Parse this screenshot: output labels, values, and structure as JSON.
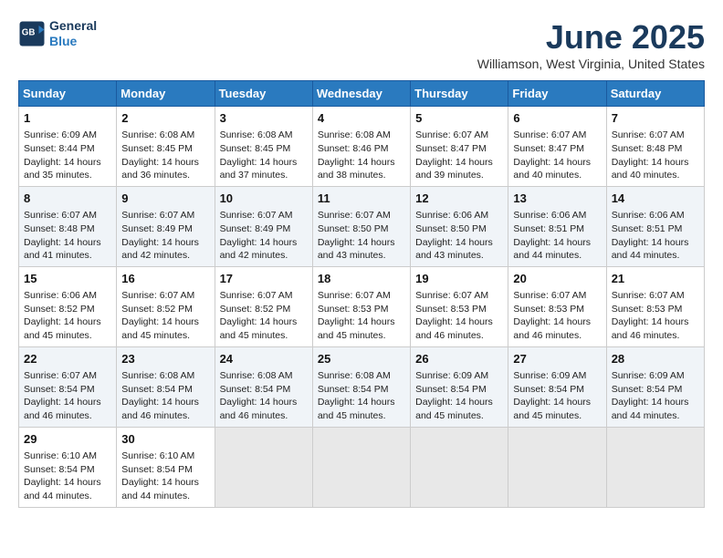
{
  "header": {
    "logo_line1": "General",
    "logo_line2": "Blue",
    "month": "June 2025",
    "location": "Williamson, West Virginia, United States"
  },
  "weekdays": [
    "Sunday",
    "Monday",
    "Tuesday",
    "Wednesday",
    "Thursday",
    "Friday",
    "Saturday"
  ],
  "weeks": [
    [
      {
        "day": "1",
        "rise": "6:09 AM",
        "set": "8:44 PM",
        "daylight": "14 hours and 35 minutes."
      },
      {
        "day": "2",
        "rise": "6:08 AM",
        "set": "8:45 PM",
        "daylight": "14 hours and 36 minutes."
      },
      {
        "day": "3",
        "rise": "6:08 AM",
        "set": "8:45 PM",
        "daylight": "14 hours and 37 minutes."
      },
      {
        "day": "4",
        "rise": "6:08 AM",
        "set": "8:46 PM",
        "daylight": "14 hours and 38 minutes."
      },
      {
        "day": "5",
        "rise": "6:07 AM",
        "set": "8:47 PM",
        "daylight": "14 hours and 39 minutes."
      },
      {
        "day": "6",
        "rise": "6:07 AM",
        "set": "8:47 PM",
        "daylight": "14 hours and 40 minutes."
      },
      {
        "day": "7",
        "rise": "6:07 AM",
        "set": "8:48 PM",
        "daylight": "14 hours and 40 minutes."
      }
    ],
    [
      {
        "day": "8",
        "rise": "6:07 AM",
        "set": "8:48 PM",
        "daylight": "14 hours and 41 minutes."
      },
      {
        "day": "9",
        "rise": "6:07 AM",
        "set": "8:49 PM",
        "daylight": "14 hours and 42 minutes."
      },
      {
        "day": "10",
        "rise": "6:07 AM",
        "set": "8:49 PM",
        "daylight": "14 hours and 42 minutes."
      },
      {
        "day": "11",
        "rise": "6:07 AM",
        "set": "8:50 PM",
        "daylight": "14 hours and 43 minutes."
      },
      {
        "day": "12",
        "rise": "6:06 AM",
        "set": "8:50 PM",
        "daylight": "14 hours and 43 minutes."
      },
      {
        "day": "13",
        "rise": "6:06 AM",
        "set": "8:51 PM",
        "daylight": "14 hours and 44 minutes."
      },
      {
        "day": "14",
        "rise": "6:06 AM",
        "set": "8:51 PM",
        "daylight": "14 hours and 44 minutes."
      }
    ],
    [
      {
        "day": "15",
        "rise": "6:06 AM",
        "set": "8:52 PM",
        "daylight": "14 hours and 45 minutes."
      },
      {
        "day": "16",
        "rise": "6:07 AM",
        "set": "8:52 PM",
        "daylight": "14 hours and 45 minutes."
      },
      {
        "day": "17",
        "rise": "6:07 AM",
        "set": "8:52 PM",
        "daylight": "14 hours and 45 minutes."
      },
      {
        "day": "18",
        "rise": "6:07 AM",
        "set": "8:53 PM",
        "daylight": "14 hours and 45 minutes."
      },
      {
        "day": "19",
        "rise": "6:07 AM",
        "set": "8:53 PM",
        "daylight": "14 hours and 46 minutes."
      },
      {
        "day": "20",
        "rise": "6:07 AM",
        "set": "8:53 PM",
        "daylight": "14 hours and 46 minutes."
      },
      {
        "day": "21",
        "rise": "6:07 AM",
        "set": "8:53 PM",
        "daylight": "14 hours and 46 minutes."
      }
    ],
    [
      {
        "day": "22",
        "rise": "6:07 AM",
        "set": "8:54 PM",
        "daylight": "14 hours and 46 minutes."
      },
      {
        "day": "23",
        "rise": "6:08 AM",
        "set": "8:54 PM",
        "daylight": "14 hours and 46 minutes."
      },
      {
        "day": "24",
        "rise": "6:08 AM",
        "set": "8:54 PM",
        "daylight": "14 hours and 46 minutes."
      },
      {
        "day": "25",
        "rise": "6:08 AM",
        "set": "8:54 PM",
        "daylight": "14 hours and 45 minutes."
      },
      {
        "day": "26",
        "rise": "6:09 AM",
        "set": "8:54 PM",
        "daylight": "14 hours and 45 minutes."
      },
      {
        "day": "27",
        "rise": "6:09 AM",
        "set": "8:54 PM",
        "daylight": "14 hours and 45 minutes."
      },
      {
        "day": "28",
        "rise": "6:09 AM",
        "set": "8:54 PM",
        "daylight": "14 hours and 44 minutes."
      }
    ],
    [
      {
        "day": "29",
        "rise": "6:10 AM",
        "set": "8:54 PM",
        "daylight": "14 hours and 44 minutes."
      },
      {
        "day": "30",
        "rise": "6:10 AM",
        "set": "8:54 PM",
        "daylight": "14 hours and 44 minutes."
      },
      {
        "day": "",
        "rise": "",
        "set": "",
        "daylight": ""
      },
      {
        "day": "",
        "rise": "",
        "set": "",
        "daylight": ""
      },
      {
        "day": "",
        "rise": "",
        "set": "",
        "daylight": ""
      },
      {
        "day": "",
        "rise": "",
        "set": "",
        "daylight": ""
      },
      {
        "day": "",
        "rise": "",
        "set": "",
        "daylight": ""
      }
    ]
  ]
}
